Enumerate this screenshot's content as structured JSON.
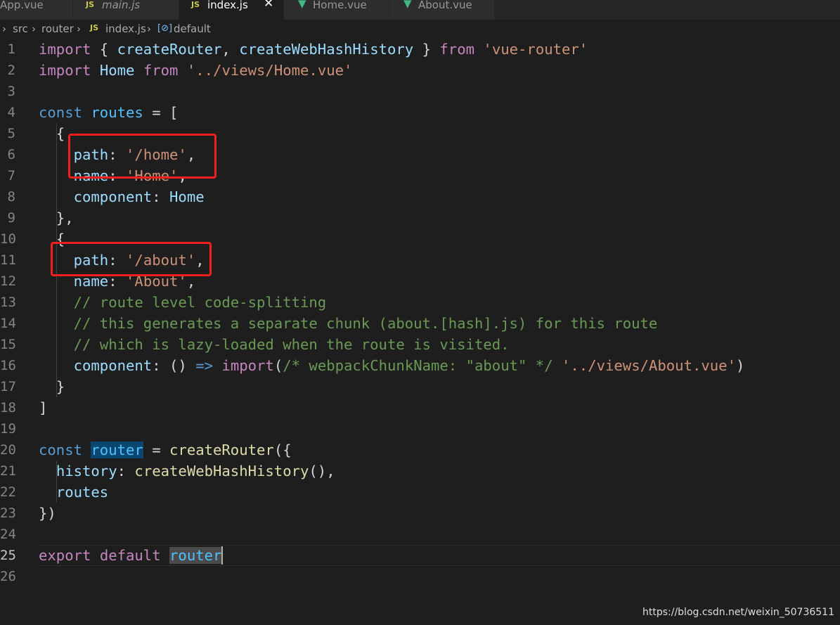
{
  "tabs": [
    {
      "label": "App.vue",
      "icon": "vue-icon",
      "active": false
    },
    {
      "label": "main.js",
      "icon": "js-icon",
      "active": false
    },
    {
      "label": "index.js",
      "icon": "js-icon",
      "active": true
    },
    {
      "label": "Home.vue",
      "icon": "vue-icon",
      "active": false
    },
    {
      "label": "About.vue",
      "icon": "vue-icon",
      "active": false
    }
  ],
  "js_icon_text": "JS",
  "breadcrumb": {
    "items": [
      "src",
      "router",
      "index.js",
      "default"
    ]
  },
  "editor": {
    "current_line": 25,
    "lines": [
      [
        [
          "import",
          "c"
        ],
        [
          " { ",
          "p"
        ],
        [
          "createRouter",
          "v"
        ],
        [
          ", ",
          "p"
        ],
        [
          "createWebHashHistory",
          "v"
        ],
        [
          " } ",
          "p"
        ],
        [
          "from",
          "c"
        ],
        [
          " ",
          "p"
        ],
        [
          "'vue-router'",
          "s"
        ]
      ],
      [
        [
          "import",
          "c"
        ],
        [
          " ",
          "p"
        ],
        [
          "Home",
          "v"
        ],
        [
          " ",
          "p"
        ],
        [
          "from",
          "c"
        ],
        [
          " ",
          "p"
        ],
        [
          "'../views/Home.vue'",
          "s"
        ]
      ],
      [],
      [
        [
          "const",
          "k"
        ],
        [
          " ",
          "p"
        ],
        [
          "routes",
          "t"
        ],
        [
          " = [",
          "p"
        ]
      ],
      [
        [
          "  {",
          "p"
        ]
      ],
      [
        [
          "    ",
          "p"
        ],
        [
          "path",
          "v"
        ],
        [
          ": ",
          "p"
        ],
        [
          "'/home'",
          "s"
        ],
        [
          ",",
          "p"
        ]
      ],
      [
        [
          "    ",
          "p"
        ],
        [
          "name",
          "v"
        ],
        [
          ": ",
          "p"
        ],
        [
          "'Home'",
          "s"
        ],
        [
          ",",
          "p"
        ]
      ],
      [
        [
          "    ",
          "p"
        ],
        [
          "component",
          "v"
        ],
        [
          ": ",
          "p"
        ],
        [
          "Home",
          "v"
        ]
      ],
      [
        [
          "  },",
          "p"
        ]
      ],
      [
        [
          "  {",
          "p"
        ]
      ],
      [
        [
          "    ",
          "p"
        ],
        [
          "path",
          "v"
        ],
        [
          ": ",
          "p"
        ],
        [
          "'/about'",
          "s"
        ],
        [
          ",",
          "p"
        ]
      ],
      [
        [
          "    ",
          "p"
        ],
        [
          "name",
          "v"
        ],
        [
          ": ",
          "p"
        ],
        [
          "'About'",
          "s"
        ],
        [
          ",",
          "p"
        ]
      ],
      [
        [
          "    ",
          "p"
        ],
        [
          "// route level code-splitting",
          "m"
        ]
      ],
      [
        [
          "    ",
          "p"
        ],
        [
          "// this generates a separate chunk (about.[hash].js) for this route",
          "m"
        ]
      ],
      [
        [
          "    ",
          "p"
        ],
        [
          "// which is lazy-loaded when the route is visited.",
          "m"
        ]
      ],
      [
        [
          "    ",
          "p"
        ],
        [
          "component",
          "v"
        ],
        [
          ": () ",
          "p"
        ],
        [
          "=>",
          "k"
        ],
        [
          " ",
          "p"
        ],
        [
          "import",
          "c"
        ],
        [
          "(",
          "p"
        ],
        [
          "/* webpackChunkName: \"about\" */",
          "m"
        ],
        [
          " ",
          "p"
        ],
        [
          "'../views/About.vue'",
          "s"
        ],
        [
          ")",
          "p"
        ]
      ],
      [
        [
          "  }",
          "p"
        ]
      ],
      [
        [
          "]",
          "p"
        ]
      ],
      [],
      [
        [
          "const",
          "k"
        ],
        [
          " ",
          "p"
        ],
        [
          "router",
          "t",
          "sel"
        ],
        [
          " = ",
          "p"
        ],
        [
          "createRouter",
          "f"
        ],
        [
          "({",
          "p"
        ]
      ],
      [
        [
          "  ",
          "p"
        ],
        [
          "history",
          "v"
        ],
        [
          ": ",
          "p"
        ],
        [
          "createWebHashHistory",
          "f"
        ],
        [
          "(),",
          "p"
        ]
      ],
      [
        [
          "  ",
          "p"
        ],
        [
          "routes",
          "v"
        ]
      ],
      [
        [
          "})",
          "p"
        ]
      ],
      [],
      [
        [
          "export",
          "c"
        ],
        [
          " ",
          "p"
        ],
        [
          "default",
          "c"
        ],
        [
          " ",
          "p"
        ],
        [
          "router",
          "t",
          "hl"
        ]
      ],
      []
    ]
  },
  "watermark": "https://blog.csdn.net/weixin_50736511",
  "colors": {
    "annotation": "#f21f1f",
    "background": "#1e1e1e"
  }
}
